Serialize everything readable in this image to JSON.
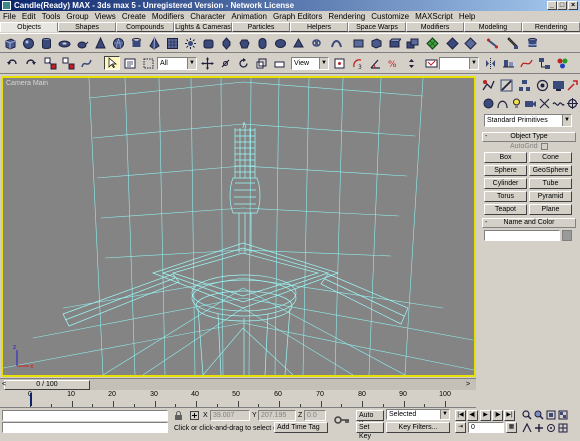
{
  "window": {
    "title": "Candle(Ready) MAX - 3ds max 5 - Unregistered Version - Network License",
    "minimize": "_",
    "maximize": "□",
    "close": "×"
  },
  "menu": [
    "File",
    "Edit",
    "Tools",
    "Group",
    "Views",
    "Create",
    "Modifiers",
    "Character",
    "Animation",
    "Graph Editors",
    "Rendering",
    "Customize",
    "MAXScript",
    "Help"
  ],
  "tabs": [
    "Objects",
    "Shapes",
    "Compounds",
    "Lights & Cameras",
    "Particles",
    "Helpers",
    "Space Warps",
    "Modifiers",
    "Modeling",
    "Rendering"
  ],
  "active_tab": "Objects",
  "toolbar2": {
    "selection_filter": "All",
    "reference_coord": "View"
  },
  "viewport": {
    "label": "Camera Main"
  },
  "command_panel": {
    "category": "Standard Primitives",
    "object_type_title": "Object Type",
    "autogrid_label": "AutoGrid",
    "buttons": [
      "Box",
      "Cone",
      "Sphere",
      "GeoSphere",
      "Cylinder",
      "Tube",
      "Torus",
      "Pyramid",
      "Teapot",
      "Plane"
    ],
    "name_color_title": "Name and Color",
    "rollout_sign": "-"
  },
  "trackbar": {
    "frame": "0 / 100"
  },
  "ruler": {
    "labels": [
      "0",
      "10",
      "20",
      "30",
      "40",
      "50",
      "60",
      "70",
      "80",
      "90",
      "100"
    ]
  },
  "status": {
    "x_label": "X",
    "x_value": "39.007",
    "y_label": "Y",
    "y_value": "207.195",
    "z_label": "Z",
    "z_value": "0.0",
    "prompt": "Click or click-and-drag to select obj",
    "add_time_tag": "Add Time Tag",
    "auto_key": "Auto Key",
    "set_key": "Set Key",
    "selected": "Selected",
    "key_filters": "Key Filters...",
    "current_frame": "0"
  },
  "colors": {
    "wireframe": "#8ff0f0",
    "viewport_bg": "#848484",
    "active_border": "#e8e000",
    "title_gradient_start": "#0a246a"
  }
}
